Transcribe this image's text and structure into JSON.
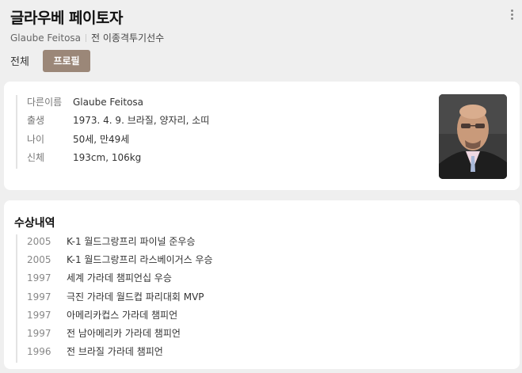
{
  "header": {
    "title": "글라우베 페이토자",
    "alias": "Glaube Feitosa",
    "job": "전 이종격투기선수"
  },
  "tabs": [
    {
      "label": "전체",
      "active": false
    },
    {
      "label": "프로필",
      "active": true
    }
  ],
  "profile": {
    "rows": [
      {
        "label": "다른이름",
        "value": "Glaube Feitosa"
      },
      {
        "label": "출생",
        "value": "1973. 4. 9. 브라질, 양자리, 소띠"
      },
      {
        "label": "나이",
        "value": "50세, 만49세"
      },
      {
        "label": "신체",
        "value": "193cm, 106kg"
      }
    ]
  },
  "awards": {
    "title": "수상내역",
    "items": [
      {
        "year": "2005",
        "name": "K-1 월드그랑프리 파이널 준우승"
      },
      {
        "year": "2005",
        "name": "K-1 월드그랑프리 라스베이거스 우승"
      },
      {
        "year": "1997",
        "name": "세계 가라데 챔피언십 우승"
      },
      {
        "year": "1997",
        "name": "극진 가라데 월드컵 파리대회 MVP"
      },
      {
        "year": "1997",
        "name": "아메리카컵스 가라데 챔피언"
      },
      {
        "year": "1997",
        "name": "전 남아메리카 가라데 챔피언"
      },
      {
        "year": "1996",
        "name": "전 브라질 가라데 챔피언"
      }
    ]
  },
  "colors": {
    "accent": "#9b8778",
    "background": "#efefef"
  }
}
